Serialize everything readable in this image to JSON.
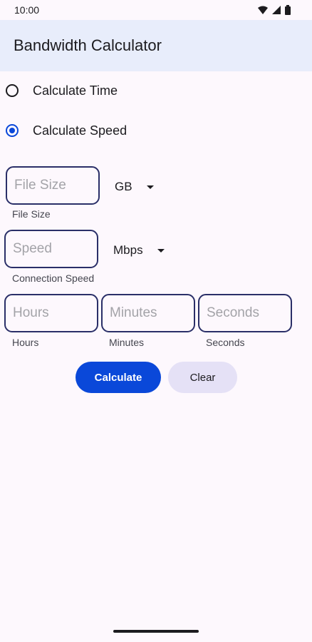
{
  "status_bar": {
    "time": "10:00",
    "icons": [
      "wifi-icon",
      "signal-icon",
      "battery-icon"
    ]
  },
  "app_bar": {
    "title": "Bandwidth Calculator"
  },
  "mode": {
    "options": [
      {
        "label": "Calculate Time",
        "selected": false
      },
      {
        "label": "Calculate Speed",
        "selected": true
      }
    ]
  },
  "file_size": {
    "placeholder": "File Size",
    "value": "",
    "helper": "File Size",
    "unit": "GB"
  },
  "speed": {
    "placeholder": "Speed",
    "value": "",
    "helper": "Connection Speed",
    "unit": "Mbps"
  },
  "duration": {
    "hours": {
      "placeholder": "Hours",
      "value": "",
      "helper": "Hours"
    },
    "minutes": {
      "placeholder": "Minutes",
      "value": "",
      "helper": "Minutes"
    },
    "seconds": {
      "placeholder": "Seconds",
      "value": "",
      "helper": "Seconds"
    }
  },
  "actions": {
    "calculate_label": "Calculate",
    "clear_label": "Clear"
  },
  "colors": {
    "accent": "#0a48d9",
    "app_bar_bg": "#e8edfb",
    "outline": "#2a2f68",
    "clear_button_bg": "#e5e1f6"
  }
}
